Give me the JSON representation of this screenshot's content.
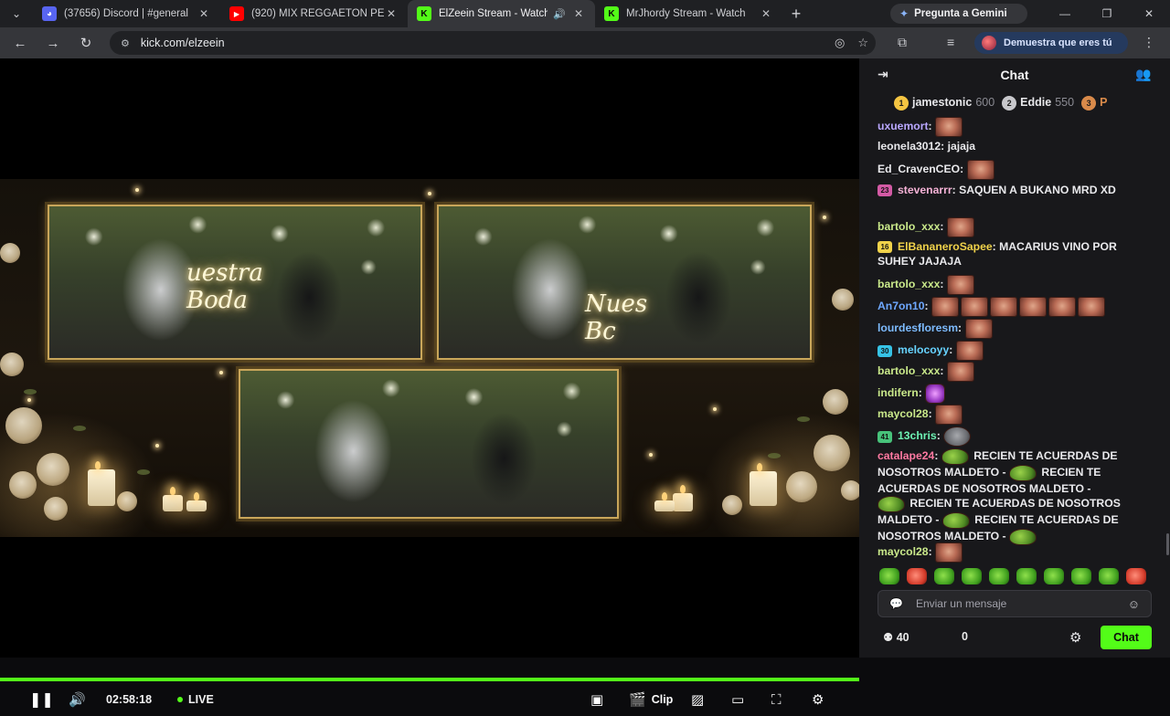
{
  "browser": {
    "tabs": [
      {
        "title": "(37656) Discord | #general",
        "favicon_color": "#5865f2",
        "active": false
      },
      {
        "title": "(920) MIX REGGAETON PE",
        "favicon_color": "#ff0000",
        "active": false
      },
      {
        "title": "ElZeein Stream - Watch",
        "favicon_color": "#53fc18",
        "active": true
      },
      {
        "title": "MrJhordy Stream - Watch",
        "favicon_color": "#53fc18",
        "active": false
      }
    ],
    "favicon_letters": {
      "kick": "K",
      "youtube": "▶",
      "discord": "◕"
    },
    "gemini_label": "Pregunta a Gemini",
    "url": "kick.com/elzeein",
    "profile_label": "Demuestra que eres tú"
  },
  "video": {
    "sign_text_1": "uestra",
    "sign_text_2": "Boda",
    "sign_text_3": "Nues",
    "sign_text_4": "Bc"
  },
  "player": {
    "time": "02:58:18",
    "live_label": "LIVE",
    "clip_label": "Clip",
    "progress": 1.0
  },
  "chat": {
    "title": "Chat",
    "leaderboard": [
      {
        "rank": "1",
        "name": "jamestonic",
        "points": "600",
        "color": "#f5c542"
      },
      {
        "rank": "2",
        "name": "Eddie",
        "points": "550",
        "color": "#c8c8cc"
      },
      {
        "rank": "3",
        "name": "P",
        "points": "",
        "color": "#d98a4a"
      }
    ],
    "messages": [
      {
        "user": "uxuemort",
        "color": "#b9a7ff",
        "text": "",
        "emotes": 1,
        "emote_kind": "face"
      },
      {
        "user": "leonela3012",
        "color": "#e9e9ec",
        "text": "jajaja",
        "emotes": 0
      },
      {
        "user": "Ed_CravenCEO",
        "color": "#e9e9ec",
        "text": "",
        "emotes": 1,
        "emote_kind": "face"
      },
      {
        "user": "stevenarrr",
        "color": "#f5b2d6",
        "text": "SAQUEN A BUKANO MRD XD",
        "emotes": 0,
        "badge": "23",
        "badge_color": "#d35aa5"
      },
      {
        "user": "bartolo_xxx",
        "color": "#c9e88a",
        "text": "",
        "emotes": 1,
        "emote_kind": "face"
      },
      {
        "user": "ElBananeroSapee",
        "color": "#f0d24a",
        "text": "MACARIUS VINO POR SUHEY JAJAJA",
        "emotes": 0,
        "badge": "16",
        "badge_color": "#f0d24a"
      },
      {
        "user": "bartolo_xxx",
        "color": "#c9e88a",
        "text": "",
        "emotes": 1,
        "emote_kind": "face"
      },
      {
        "user": "An7on10",
        "color": "#6ea8ff",
        "text": "",
        "emotes": 6,
        "emote_kind": "face"
      },
      {
        "user": "lourdesfloresm",
        "color": "#7dbbff",
        "text": "",
        "emotes": 1,
        "emote_kind": "face"
      },
      {
        "user": "melocoyy",
        "color": "#67d3ff",
        "text": "",
        "emotes": 1,
        "emote_kind": "face",
        "badge": "30",
        "badge_color": "#36c3e6"
      },
      {
        "user": "bartolo_xxx",
        "color": "#c9e88a",
        "text": "",
        "emotes": 1,
        "emote_kind": "face"
      },
      {
        "user": "indifern",
        "color": "#c9e88a",
        "text": "",
        "emotes": 1,
        "emote_kind": "purple"
      },
      {
        "user": "maycol28",
        "color": "#c9e88a",
        "text": "",
        "emotes": 1,
        "emote_kind": "face"
      },
      {
        "user": "13chris",
        "color": "#6ef2b4",
        "text": "",
        "emotes": 1,
        "emote_kind": "grey",
        "badge": "41",
        "badge_color": "#47c27a"
      },
      {
        "user": "catalape24",
        "color": "#ff7aa2",
        "text_lines": [
          "RECIEN TE ACUERDAS DE",
          "NOSOTROS MALDETO - ",
          "RECIEN TE",
          "ACUERDAS DE NOSOTROS MALDETO -",
          "RECIEN TE ACUERDAS DE NOSOTROS",
          "MALDETO - ",
          "RECIEN TE ACUERDAS DE",
          "NOSOTROS MALDETO - "
        ],
        "emotes": 0
      },
      {
        "user": "maycol28",
        "color": "#c9e88a",
        "text": "",
        "emotes": 1,
        "emote_kind": "face"
      }
    ],
    "input_placeholder": "Enviar un mensaje",
    "viewer_count": "40",
    "secondary_count": "0",
    "send_label": "Chat"
  },
  "colors": {
    "kick_green": "#53fc18",
    "chat_bg": "#18181b",
    "chrome_bg": "#35363a"
  },
  "icons": [
    "menu-chevron-icon",
    "close-icon",
    "speaker-icon",
    "plus-icon",
    "gemini-star-icon",
    "minimize-icon",
    "maximize-icon",
    "back-icon",
    "forward-icon",
    "reload-icon",
    "site-info-icon",
    "eye-slash-icon",
    "star-icon",
    "extensions-icon",
    "media-icon",
    "kebab-icon",
    "collapse-chat-icon",
    "users-icon",
    "pause-icon",
    "volume-icon",
    "theater-icon",
    "clip-icon",
    "no-video-icon",
    "mini-player-icon",
    "fullscreen-icon",
    "settings-icon",
    "emoji-icon",
    "chat-bubble-icon"
  ]
}
